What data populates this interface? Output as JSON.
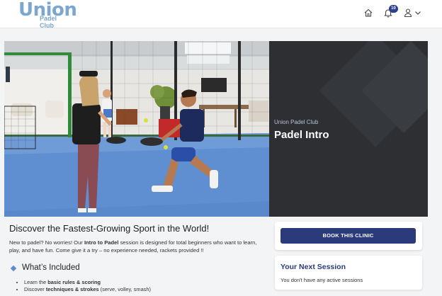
{
  "brand": {
    "logo_main": "Union",
    "logo_sub": "Padel Club"
  },
  "nav": {
    "notification_count": "10",
    "icons": [
      "home-icon",
      "bell-icon",
      "user-icon",
      "chevron-down-icon"
    ]
  },
  "hero": {
    "subtitle": "Union Padel Club",
    "title": "Padel Intro"
  },
  "main": {
    "headline": "Discover the Fastest-Growing Sport in the World!",
    "intro": {
      "part1": "New to padel? No worries! Our ",
      "bold": "Intro to Padel",
      "part2": " session is designed for total beginners who want to learn, play, and have fun. Come give it a try – no experience needed, rackets provided !!"
    },
    "section_title": "What’s Included",
    "bullets": [
      {
        "prefix": "Learn the ",
        "bold": "basic rules & scoring",
        "suffix": ""
      },
      {
        "prefix": "Discover ",
        "bold": "techniques & strokes",
        "suffix": " (serve, volley, smash)"
      }
    ]
  },
  "sidebar": {
    "book_label": "BOOK THIS CLINIC",
    "session_title": "Your Next Session",
    "session_text": "You don't have any active sessions"
  },
  "colors": {
    "accent": "#2b3a7a",
    "brand_blue": "#7aa7cf",
    "panel_dark": "#2d2f33",
    "court_blue": "#5f8fd0"
  }
}
